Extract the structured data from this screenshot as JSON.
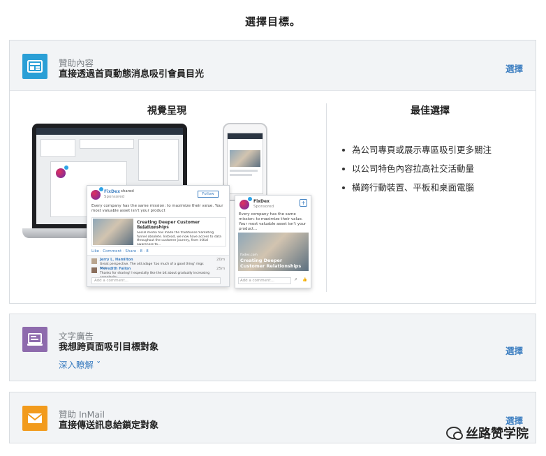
{
  "page": {
    "title": "選擇目標。"
  },
  "cards": {
    "sponsored": {
      "kicker": "贊助內容",
      "headline": "直接透過首頁動態消息吸引會員目光",
      "select": "選擇",
      "icon": "article-icon",
      "icon_color": "#2a9fd6",
      "visual_title": "視覺呈現",
      "best_title": "最佳選擇",
      "bullets": [
        "為公司專頁或展示專區吸引更多關注",
        "以公司特色內容拉高社交活動量",
        "橫跨行動裝置、平板和桌面電腦"
      ],
      "preview": {
        "company": "FixDex",
        "shared": "shared",
        "sponsored": "Sponsored",
        "follow": "Follow",
        "post_text": "Every company has the same mission: to maximize their value. Your most valuable asset isn't your product",
        "mobile_post_text": "Every company has the same mission: to maximize their value. Your most valuable asset isn't your product...",
        "article_title": "Creating Deeper Customer Relationships",
        "article_source": "fixdex.com",
        "article_desc": "Social media has made the traditional marketing funnel obsolete. Instead, we now have access to data throughout the customer journey, from initial awareness to...",
        "actions": "Like · Comment · Share · 8 · 8",
        "comments": [
          {
            "name": "Jerry L. Hamilton",
            "text": "Great perspective. The old adage 'too much of a good thing' rings true.",
            "time": "20m"
          },
          {
            "name": "Meredith Fallon",
            "text": "Thanks for sharing! I especially like the bit about gradually increasing complexity.",
            "time": "25m"
          }
        ],
        "add_comment": "Add a comment...",
        "mobile_add_comment": "Add a comment...",
        "mobile_article_title": "Creating Deeper Customer Relationships",
        "mobile_article_source": "fixdex.com"
      }
    },
    "text_ads": {
      "kicker": "文字廣告",
      "headline": "我想跨頁面吸引目標對象",
      "learn_more": "深入瞭解 ˅",
      "select": "選擇",
      "icon": "monitor-icon",
      "icon_color": "#8e6bad"
    },
    "inmail": {
      "kicker": "贊助 InMail",
      "headline": "直接傳送訊息給鎖定對象",
      "select": "選擇",
      "icon": "envelope-icon",
      "icon_color": "#f29b1d"
    }
  },
  "watermark": {
    "text": "丝路赞学院"
  }
}
